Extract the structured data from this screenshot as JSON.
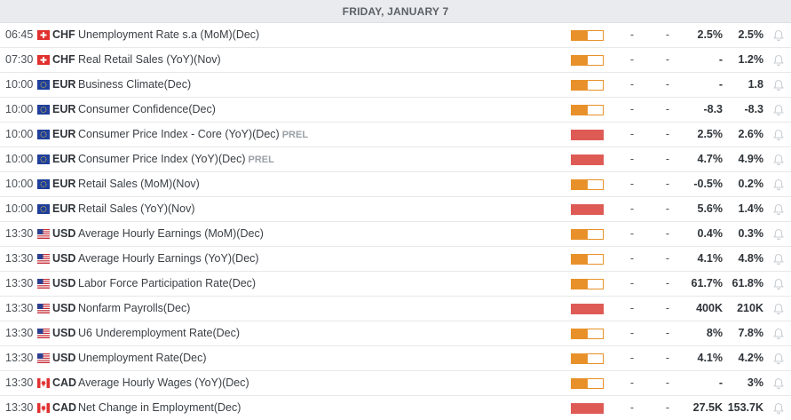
{
  "day_header": "FRIDAY, JANUARY 7",
  "colors": {
    "impact_high": "#de5a55",
    "impact_medium": "#e8912a",
    "header_bg": "#e9ebee"
  },
  "events": [
    {
      "time": "06:45",
      "currency": "CHF",
      "flag": "switzerland-flag",
      "name": "Unemployment Rate s.a (MoM)(Dec)",
      "tag": "",
      "impact": "medium",
      "actual": "-",
      "deviation": "-",
      "previous": "2.5%",
      "consensus": "2.5%"
    },
    {
      "time": "07:30",
      "currency": "CHF",
      "flag": "switzerland-flag",
      "name": "Real Retail Sales (YoY)(Nov)",
      "tag": "",
      "impact": "medium",
      "actual": "-",
      "deviation": "-",
      "previous": "-",
      "consensus": "1.2%"
    },
    {
      "time": "10:00",
      "currency": "EUR",
      "flag": "eu-flag",
      "name": "Business Climate(Dec)",
      "tag": "",
      "impact": "medium",
      "actual": "-",
      "deviation": "-",
      "previous": "-",
      "consensus": "1.8"
    },
    {
      "time": "10:00",
      "currency": "EUR",
      "flag": "eu-flag",
      "name": "Consumer Confidence(Dec)",
      "tag": "",
      "impact": "medium",
      "actual": "-",
      "deviation": "-",
      "previous": "-8.3",
      "consensus": "-8.3"
    },
    {
      "time": "10:00",
      "currency": "EUR",
      "flag": "eu-flag",
      "name": "Consumer Price Index - Core (YoY)(Dec)",
      "tag": "PREL",
      "impact": "high",
      "actual": "-",
      "deviation": "-",
      "previous": "2.5%",
      "consensus": "2.6%"
    },
    {
      "time": "10:00",
      "currency": "EUR",
      "flag": "eu-flag",
      "name": "Consumer Price Index (YoY)(Dec)",
      "tag": "PREL",
      "impact": "high",
      "actual": "-",
      "deviation": "-",
      "previous": "4.7%",
      "consensus": "4.9%"
    },
    {
      "time": "10:00",
      "currency": "EUR",
      "flag": "eu-flag",
      "name": "Retail Sales (MoM)(Nov)",
      "tag": "",
      "impact": "medium",
      "actual": "-",
      "deviation": "-",
      "previous": "-0.5%",
      "consensus": "0.2%"
    },
    {
      "time": "10:00",
      "currency": "EUR",
      "flag": "eu-flag",
      "name": "Retail Sales (YoY)(Nov)",
      "tag": "",
      "impact": "high",
      "actual": "-",
      "deviation": "-",
      "previous": "5.6%",
      "consensus": "1.4%"
    },
    {
      "time": "13:30",
      "currency": "USD",
      "flag": "us-flag",
      "name": "Average Hourly Earnings (MoM)(Dec)",
      "tag": "",
      "impact": "medium",
      "actual": "-",
      "deviation": "-",
      "previous": "0.4%",
      "consensus": "0.3%"
    },
    {
      "time": "13:30",
      "currency": "USD",
      "flag": "us-flag",
      "name": "Average Hourly Earnings (YoY)(Dec)",
      "tag": "",
      "impact": "medium",
      "actual": "-",
      "deviation": "-",
      "previous": "4.1%",
      "consensus": "4.8%"
    },
    {
      "time": "13:30",
      "currency": "USD",
      "flag": "us-flag",
      "name": "Labor Force Participation Rate(Dec)",
      "tag": "",
      "impact": "medium",
      "actual": "-",
      "deviation": "-",
      "previous": "61.7%",
      "consensus": "61.8%"
    },
    {
      "time": "13:30",
      "currency": "USD",
      "flag": "us-flag",
      "name": "Nonfarm Payrolls(Dec)",
      "tag": "",
      "impact": "high",
      "actual": "-",
      "deviation": "-",
      "previous": "400K",
      "consensus": "210K"
    },
    {
      "time": "13:30",
      "currency": "USD",
      "flag": "us-flag",
      "name": "U6 Underemployment Rate(Dec)",
      "tag": "",
      "impact": "medium",
      "actual": "-",
      "deviation": "-",
      "previous": "8%",
      "consensus": "7.8%"
    },
    {
      "time": "13:30",
      "currency": "USD",
      "flag": "us-flag",
      "name": "Unemployment Rate(Dec)",
      "tag": "",
      "impact": "medium",
      "actual": "-",
      "deviation": "-",
      "previous": "4.1%",
      "consensus": "4.2%"
    },
    {
      "time": "13:30",
      "currency": "CAD",
      "flag": "canada-flag",
      "name": "Average Hourly Wages (YoY)(Dec)",
      "tag": "",
      "impact": "medium",
      "actual": "-",
      "deviation": "-",
      "previous": "-",
      "consensus": "3%"
    },
    {
      "time": "13:30",
      "currency": "CAD",
      "flag": "canada-flag",
      "name": "Net Change in Employment(Dec)",
      "tag": "",
      "impact": "high",
      "actual": "-",
      "deviation": "-",
      "previous": "27.5K",
      "consensus": "153.7K"
    }
  ]
}
